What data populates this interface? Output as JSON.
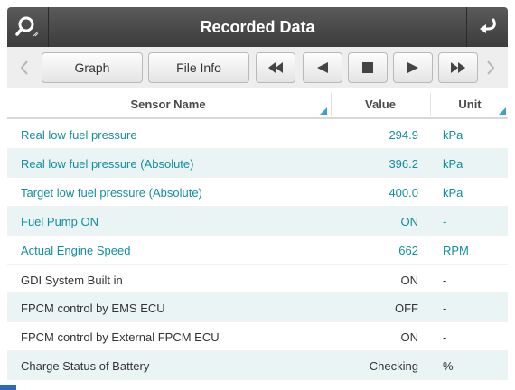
{
  "titlebar": {
    "title": "Recorded Data",
    "left_icon": "search-icon",
    "right_icon": "back-arrow-icon"
  },
  "toolbar": {
    "prev_icon": "chevron-left-icon",
    "graph_label": "Graph",
    "file_info_label": "File Info",
    "rewind_icon": "rewind-icon",
    "play_back_icon": "play-back-icon",
    "stop_icon": "stop-icon",
    "play_icon": "play-icon",
    "fast_forward_icon": "fast-forward-icon",
    "next_icon": "chevron-right-icon"
  },
  "table": {
    "columns": {
      "name": "Sensor Name",
      "value": "Value",
      "unit": "Unit"
    },
    "rows": [
      {
        "name": "Real low fuel pressure",
        "value": "294.9",
        "unit": "kPa"
      },
      {
        "name": "Real low fuel pressure (Absolute)",
        "value": "396.2",
        "unit": "kPa"
      },
      {
        "name": "Target low fuel pressure (Absolute)",
        "value": "400.0",
        "unit": "kPa"
      },
      {
        "name": "Fuel Pump ON",
        "value": "ON",
        "unit": "-"
      },
      {
        "name": "Actual Engine Speed",
        "value": "662",
        "unit": "RPM"
      },
      {
        "name": "GDI System Built in",
        "value": "ON",
        "unit": "-"
      },
      {
        "name": "FPCM control by EMS ECU",
        "value": "OFF",
        "unit": "-"
      },
      {
        "name": "FPCM control by External FPCM ECU",
        "value": "ON",
        "unit": "-"
      },
      {
        "name": "Charge Status of Battery",
        "value": "Checking",
        "unit": "%"
      }
    ]
  },
  "colors": {
    "accent": "#138e9c",
    "titlebar": "#4a4a4a",
    "row_alt": "#eaf4f4"
  }
}
